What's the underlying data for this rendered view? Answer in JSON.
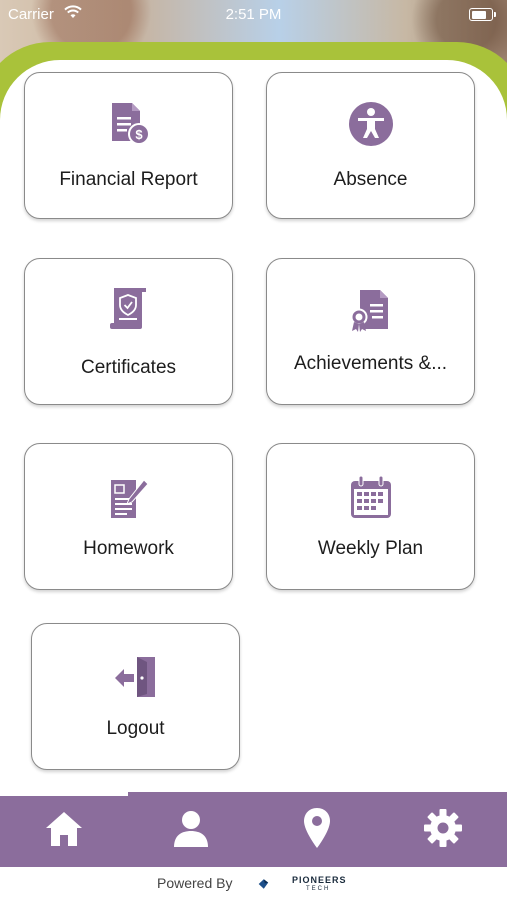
{
  "status_bar": {
    "carrier": "Carrier",
    "time": "2:51 PM"
  },
  "colors": {
    "accent": "#8b6d9c",
    "green": "#a9c23a"
  },
  "tiles": [
    {
      "label": "Financial Report",
      "icon": "financial-report-icon"
    },
    {
      "label": "Absence",
      "icon": "absence-icon"
    },
    {
      "label": "Certificates",
      "icon": "certificate-icon"
    },
    {
      "label": "Achievements &...",
      "icon": "achievements-icon"
    },
    {
      "label": "Homework",
      "icon": "homework-icon"
    },
    {
      "label": "Weekly Plan",
      "icon": "calendar-icon"
    },
    {
      "label": "Logout",
      "icon": "logout-icon"
    }
  ],
  "bottom_nav": [
    {
      "name": "home",
      "icon": "home-icon"
    },
    {
      "name": "profile",
      "icon": "user-icon"
    },
    {
      "name": "location",
      "icon": "location-pin-icon"
    },
    {
      "name": "settings",
      "icon": "gear-icon"
    }
  ],
  "footer": {
    "powered_by": "Powered By",
    "brand": "PIONEERS",
    "brand_sub": "TECH"
  }
}
